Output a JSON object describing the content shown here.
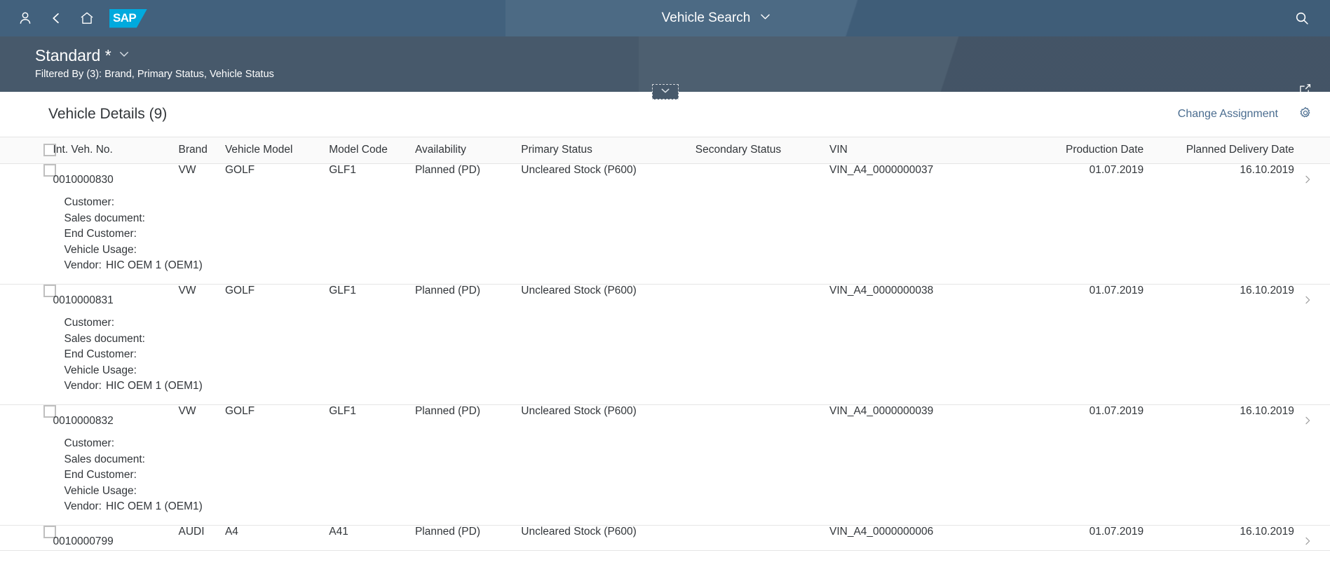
{
  "shellbar": {
    "user_icon": "person-icon",
    "back_icon": "back-chevron-icon",
    "home_icon": "home-icon",
    "logo_text": "SAP",
    "title": "Vehicle Search",
    "title_chevron_icon": "chevron-down-icon",
    "search_icon": "search-icon"
  },
  "subheader": {
    "variant_name": "Standard *",
    "variant_chevron_icon": "chevron-down-icon",
    "filtered_by": "Filtered By (3): Brand, Primary Status, Vehicle Status",
    "export_icon": "share-export-icon",
    "collapse_icon": "chevron-down-icon"
  },
  "toolbar": {
    "table_title": "Vehicle Details (9)",
    "change_assignment_label": "Change Assignment",
    "settings_icon": "gear-icon"
  },
  "table": {
    "columns": [
      "Int. Veh. No.",
      "Brand",
      "Vehicle Model",
      "Model Code",
      "Availability",
      "Primary Status",
      "Secondary Status",
      "VIN",
      "Production Date",
      "Planned Delivery Date"
    ],
    "detail_labels": {
      "customer": "Customer:",
      "sales_document": "Sales document:",
      "end_customer": "End Customer:",
      "vehicle_usage": "Vehicle Usage:",
      "vendor": "Vendor:"
    },
    "rows": [
      {
        "int_veh_no": "0010000830",
        "brand": "VW",
        "vehicle_model": "GOLF",
        "model_code": "GLF1",
        "availability": "Planned (PD)",
        "primary_status": "Uncleared Stock (P600)",
        "secondary_status": "",
        "vin": "VIN_A4_0000000037",
        "production_date": "01.07.2019",
        "planned_delivery_date": "16.10.2019",
        "customer": "",
        "sales_document": "",
        "end_customer": "",
        "vehicle_usage": "",
        "vendor": "HIC OEM 1 (OEM1)",
        "expanded": true
      },
      {
        "int_veh_no": "0010000831",
        "brand": "VW",
        "vehicle_model": "GOLF",
        "model_code": "GLF1",
        "availability": "Planned (PD)",
        "primary_status": "Uncleared Stock (P600)",
        "secondary_status": "",
        "vin": "VIN_A4_0000000038",
        "production_date": "01.07.2019",
        "planned_delivery_date": "16.10.2019",
        "customer": "",
        "sales_document": "",
        "end_customer": "",
        "vehicle_usage": "",
        "vendor": "HIC OEM 1 (OEM1)",
        "expanded": true
      },
      {
        "int_veh_no": "0010000832",
        "brand": "VW",
        "vehicle_model": "GOLF",
        "model_code": "GLF1",
        "availability": "Planned (PD)",
        "primary_status": "Uncleared Stock (P600)",
        "secondary_status": "",
        "vin": "VIN_A4_0000000039",
        "production_date": "01.07.2019",
        "planned_delivery_date": "16.10.2019",
        "customer": "",
        "sales_document": "",
        "end_customer": "",
        "vehicle_usage": "",
        "vendor": "HIC OEM 1 (OEM1)",
        "expanded": true
      },
      {
        "int_veh_no": "0010000799",
        "brand": "AUDI",
        "vehicle_model": "A4",
        "model_code": "A41",
        "availability": "Planned (PD)",
        "primary_status": "Uncleared Stock (P600)",
        "secondary_status": "",
        "vin": "VIN_A4_0000000006",
        "production_date": "01.07.2019",
        "planned_delivery_date": "16.10.2019",
        "customer": "",
        "sales_document": "",
        "end_customer": "",
        "vehicle_usage": "",
        "vendor": "",
        "expanded": false
      }
    ]
  },
  "colors": {
    "shellbar_bg": "#42617d",
    "subheader_bg": "#47596b",
    "accent_link": "#4a6c8f",
    "text_primary": "#32363a",
    "border": "#e5e5e5"
  }
}
